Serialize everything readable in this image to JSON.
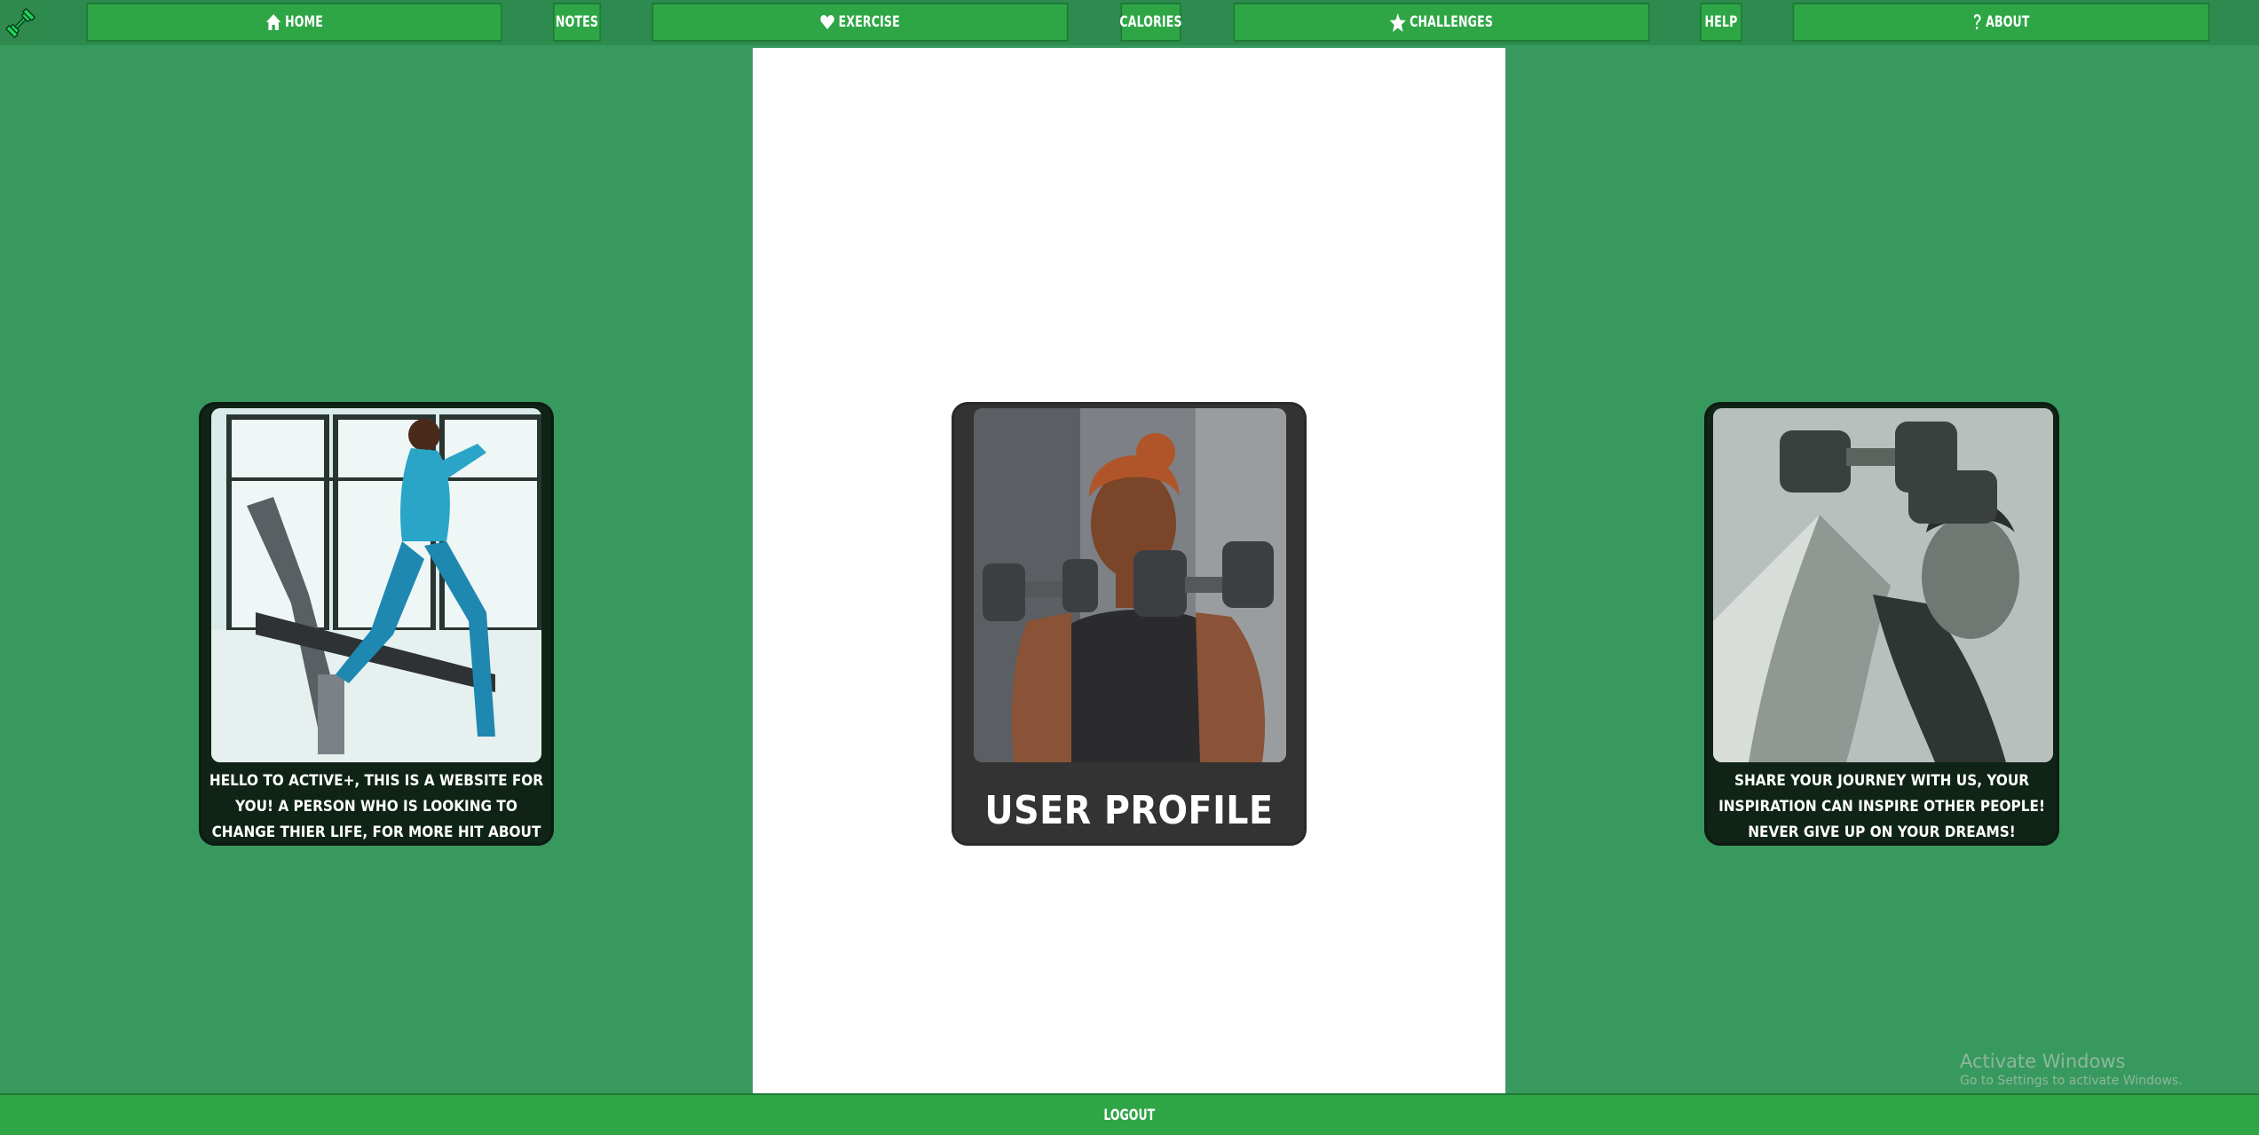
{
  "nav": {
    "logo_icon": "dumbbell-icon",
    "items": [
      {
        "label": "HOME",
        "icon": "home-icon"
      },
      {
        "label": "NOTES"
      },
      {
        "label": "EXERCISE",
        "icon": "heart-icon"
      },
      {
        "label": "CALORIES"
      },
      {
        "label": "CHALLENGES",
        "icon": "star-icon"
      },
      {
        "label": "HELP"
      },
      {
        "label": "ABOUT",
        "icon": "question-icon"
      }
    ]
  },
  "cards": {
    "left": {
      "caption": "HELLO TO ACTIVE+, THIS IS A WEBSITE FOR YOU! A PERSON WHO IS LOOKING TO CHANGE THIER LIFE, FOR MORE HIT ABOUT BUTTON!"
    },
    "center": {
      "title": "USER PROFILE"
    },
    "right": {
      "caption": "SHARE YOUR JOURNEY WITH US, YOUR INSPIRATION CAN INSPIRE OTHER PEOPLE! NEVER GIVE UP ON YOUR DREAMS!"
    }
  },
  "footer": {
    "logout_label": "LOGOUT"
  },
  "os_watermark": {
    "line1": "Activate Windows",
    "line2": "Go to Settings to activate Windows."
  },
  "colors": {
    "page_bg": "#38995e",
    "nav_button": "#2ea646",
    "panel": "#ffffff",
    "card_dark": "#0f2416",
    "card_gray": "#333333"
  }
}
